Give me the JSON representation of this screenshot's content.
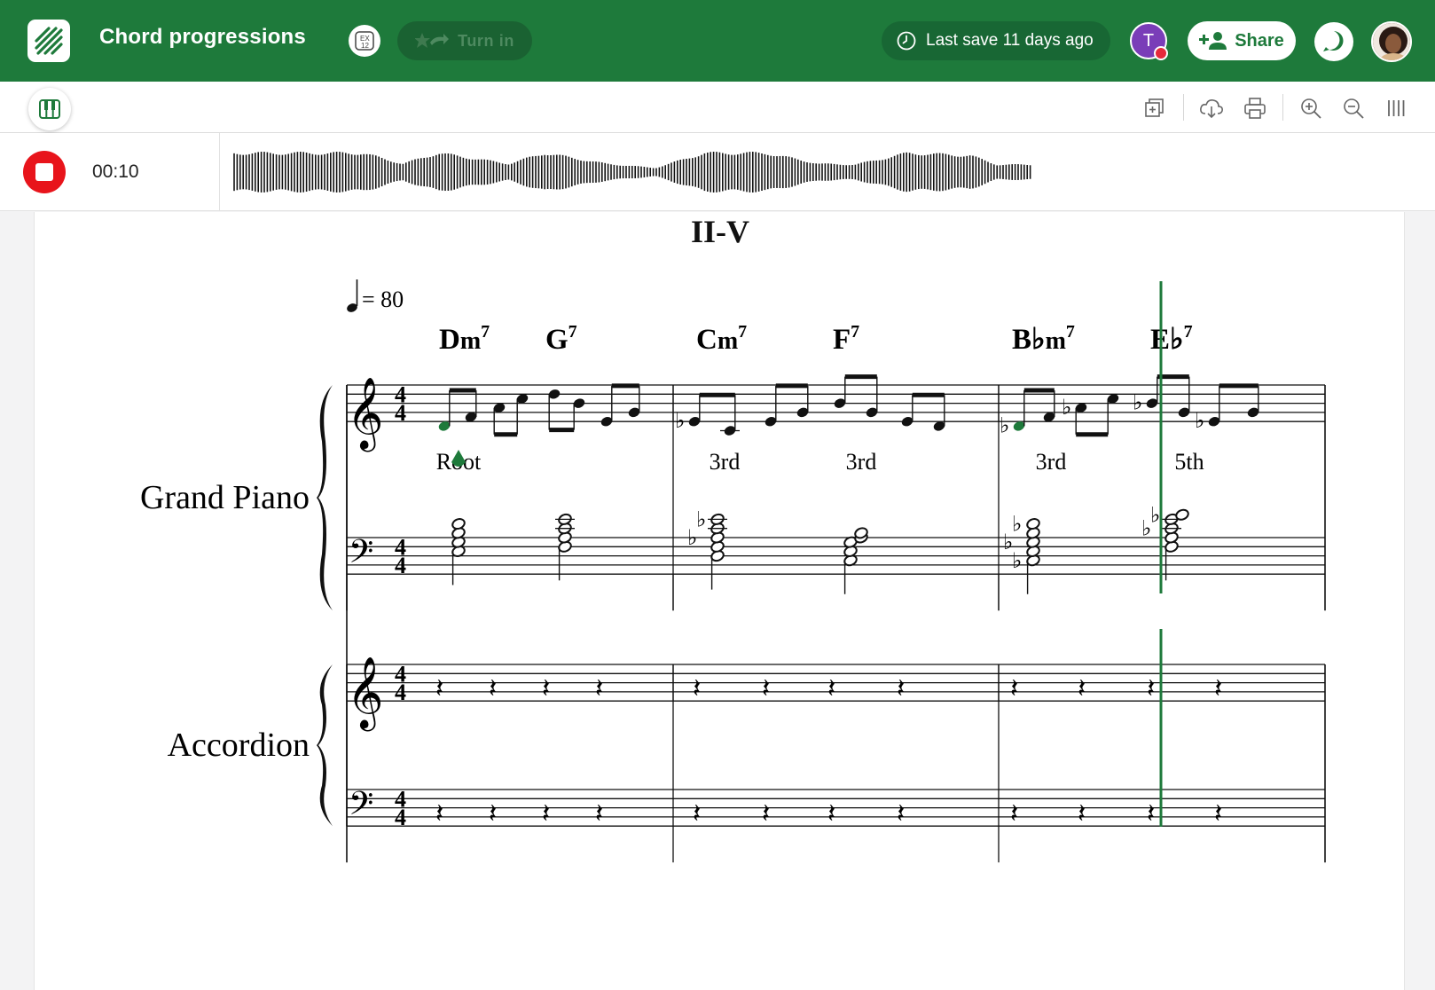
{
  "header": {
    "title": "Chord progressions",
    "metronome_label": "EX 12",
    "turn_in_label": "Turn in",
    "last_save": "Last save 11 days ago",
    "collaborator_initial": "T",
    "share_label": "Share",
    "help_symbol": "?"
  },
  "colors": {
    "brand": "#1e7a3b",
    "record": "#e8141b",
    "accent": "#1e7a3b"
  },
  "toolbar": {
    "tools": [
      "add-page-icon",
      "cloud-download-icon",
      "print-icon",
      "zoom-in-icon",
      "zoom-out-icon",
      "columns-icon"
    ]
  },
  "recording": {
    "elapsed": "00:10"
  },
  "score": {
    "title": "II-V",
    "tempo": "= 80",
    "chords": [
      {
        "root": "D",
        "quality": "m",
        "ext": "7"
      },
      {
        "root": "G",
        "quality": "",
        "ext": "7"
      },
      {
        "root": "C",
        "quality": "m",
        "ext": "7"
      },
      {
        "root": "F",
        "quality": "",
        "ext": "7"
      },
      {
        "root": "B♭",
        "quality": "m",
        "ext": "7"
      },
      {
        "root": "E♭",
        "quality": "",
        "ext": "7"
      }
    ],
    "annotations": [
      "Root",
      "3rd",
      "3rd",
      "3rd",
      "5th"
    ],
    "instruments": [
      "Grand Piano",
      "Accordion"
    ],
    "time_signature": [
      "4",
      "4"
    ]
  }
}
